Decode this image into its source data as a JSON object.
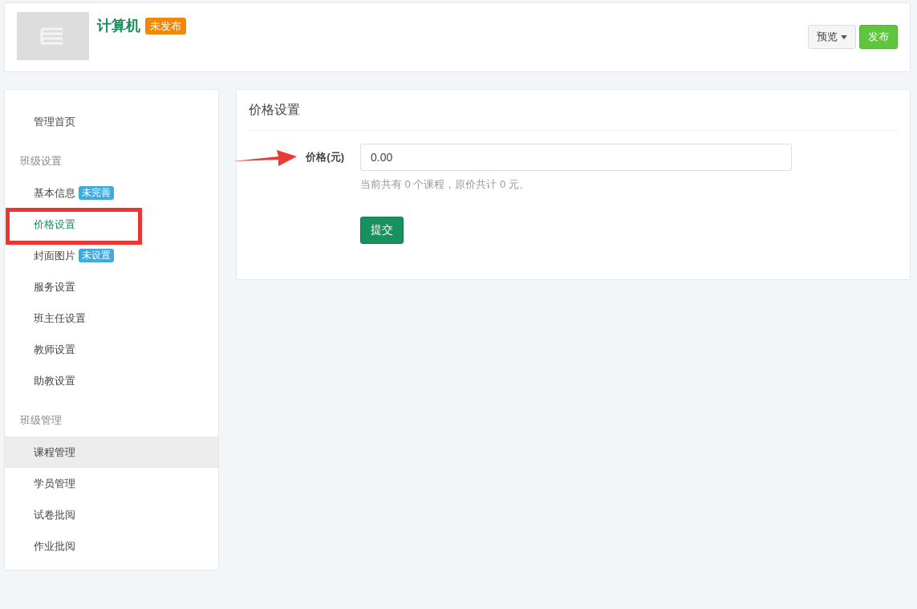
{
  "header": {
    "title": "计算机",
    "status_badge": "未发布",
    "buttons": [
      {
        "kind": "dropdown",
        "label": "预览"
      },
      {
        "kind": "primary",
        "label": "发布"
      }
    ]
  },
  "sidebar": {
    "sections": [
      {
        "items": [
          {
            "label": "管理首页",
            "selected": false,
            "hovered": false
          }
        ]
      },
      {
        "heading": "班级设置",
        "items": [
          {
            "label": "基本信息",
            "badge": "未完善",
            "selected": false,
            "hovered": false
          },
          {
            "label": "价格设置",
            "selected": true,
            "hovered": false
          },
          {
            "label": "封面图片",
            "badge": "未设置",
            "selected": false,
            "hovered": false
          },
          {
            "label": "服务设置",
            "selected": false,
            "hovered": false
          },
          {
            "label": "班主任设置",
            "selected": false,
            "hovered": false
          },
          {
            "label": "教师设置",
            "selected": false,
            "hovered": false
          },
          {
            "label": "助教设置",
            "selected": false,
            "hovered": false
          }
        ]
      },
      {
        "heading": "班级管理",
        "items": [
          {
            "label": "课程管理",
            "selected": false,
            "hovered": true
          },
          {
            "label": "学员管理",
            "selected": false,
            "hovered": false
          },
          {
            "label": "试卷批阅",
            "selected": false,
            "hovered": false
          },
          {
            "label": "作业批阅",
            "selected": false,
            "hovered": false
          }
        ]
      }
    ]
  },
  "panel": {
    "title": "价格设置",
    "field": {
      "label": "价格(元)",
      "value": "0.00",
      "help": "当前共有 0 个课程，原价共计 0 元。"
    },
    "submit": "提交"
  }
}
